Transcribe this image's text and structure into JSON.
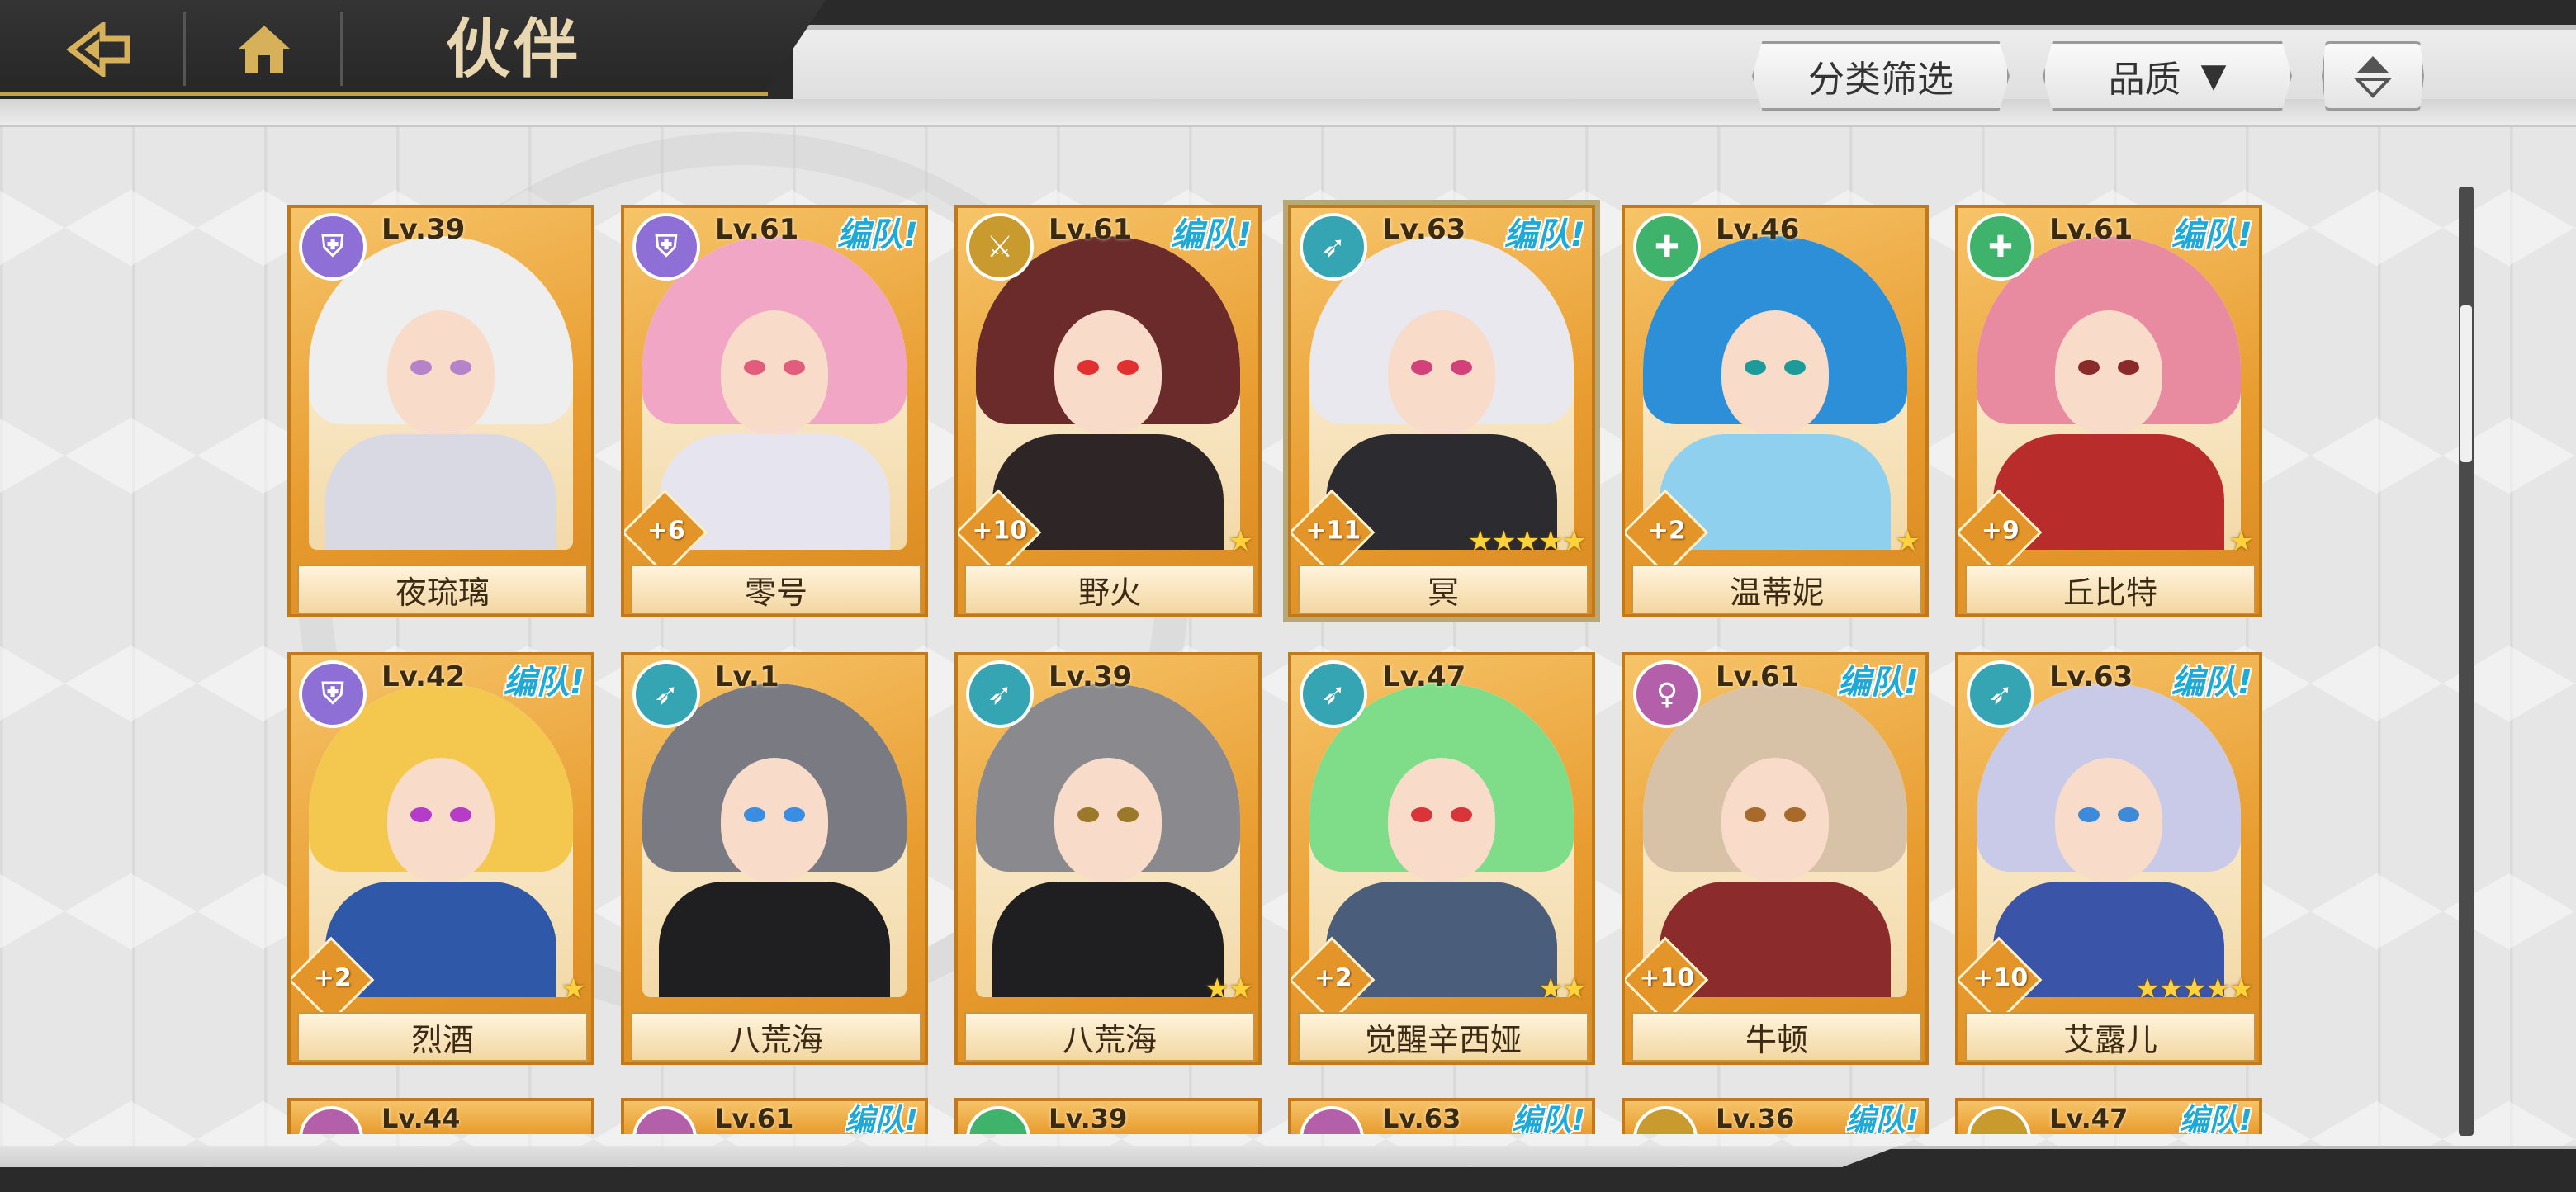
{
  "header": {
    "back_icon": "back-arrow-icon",
    "home_icon": "home-icon",
    "title": "伙伴"
  },
  "controls": {
    "filter_label": "分类筛选",
    "quality_label": "品质",
    "quality_arrow": "▼",
    "sort_icon": "sort-toggle-icon"
  },
  "colors": {
    "badge_purple": "#8e6fd6",
    "badge_teal": "#36a5b3",
    "badge_green": "#3fb36c",
    "badge_gold": "#c99a2e",
    "badge_pink": "#b45fa9",
    "team_blue": "#1fa9d6"
  },
  "cards": [
    {
      "name": "夜琉璃",
      "level": "Lv.39",
      "team": "",
      "plus": "",
      "stars": 0,
      "class": "shield",
      "badge": "#8e6fd6",
      "hair": "#eeeeee",
      "body": "#d9d9e3",
      "eye": "#b583c9"
    },
    {
      "name": "零号",
      "level": "Lv.61",
      "team": "编队!",
      "plus": "+6",
      "stars": 0,
      "class": "shield",
      "badge": "#8e6fd6",
      "hair": "#f0a6c4",
      "body": "#e6e4ee",
      "eye": "#e25d7b"
    },
    {
      "name": "野火",
      "level": "Lv.61",
      "team": "编队!",
      "plus": "+10",
      "stars": 1,
      "class": "dagger",
      "badge": "#c99a2e",
      "hair": "#6b2b2b",
      "body": "#2e2626",
      "eye": "#e22f2f"
    },
    {
      "name": "冥",
      "level": "Lv.63",
      "team": "编队!",
      "plus": "+11",
      "stars": 5,
      "class": "bow",
      "badge": "#36a5b3",
      "hair": "#e8e8ee",
      "body": "#2b2b30",
      "eye": "#d3407a"
    },
    {
      "name": "温蒂妮",
      "level": "Lv.46",
      "team": "",
      "plus": "+2",
      "stars": 1,
      "class": "heal",
      "badge": "#3fb36c",
      "hair": "#2c8fd8",
      "body": "#8fd0ee",
      "eye": "#1e9a9a"
    },
    {
      "name": "丘比特",
      "level": "Lv.61",
      "team": "编队!",
      "plus": "+9",
      "stars": 1,
      "class": "heal",
      "badge": "#3fb36c",
      "hair": "#e88aa0",
      "body": "#b82c2c",
      "eye": "#8a2a2a"
    },
    {
      "name": "烈酒",
      "level": "Lv.42",
      "team": "编队!",
      "plus": "+2",
      "stars": 1,
      "class": "shield",
      "badge": "#8e6fd6",
      "hair": "#f4c74e",
      "body": "#2f58a8",
      "eye": "#b43cc9"
    },
    {
      "name": "八荒海",
      "level": "Lv.1",
      "team": "",
      "plus": "",
      "stars": 0,
      "class": "bow",
      "badge": "#36a5b3",
      "hair": "#7a7a82",
      "body": "#1f1f22",
      "eye": "#3a8de0"
    },
    {
      "name": "八荒海",
      "level": "Lv.39",
      "team": "",
      "plus": "",
      "stars": 2,
      "class": "bow",
      "badge": "#36a5b3",
      "hair": "#8a8a8e",
      "body": "#1f1f22",
      "eye": "#9a7a2a"
    },
    {
      "name": "觉醒辛西娅",
      "level": "Lv.47",
      "team": "",
      "plus": "+2",
      "stars": 2,
      "class": "bow",
      "badge": "#36a5b3",
      "hair": "#7fdc88",
      "body": "#4a5d7a",
      "eye": "#d8343a"
    },
    {
      "name": "牛顿",
      "level": "Lv.61",
      "team": "编队!",
      "plus": "+10",
      "stars": 0,
      "class": "magic",
      "badge": "#b45fa9",
      "hair": "#d7c2a8",
      "body": "#8c2b2b",
      "eye": "#a86a2a"
    },
    {
      "name": "艾露儿",
      "level": "Lv.63",
      "team": "编队!",
      "plus": "+10",
      "stars": 5,
      "class": "bow",
      "badge": "#36a5b3",
      "hair": "#c9c9e8",
      "body": "#3a55a8",
      "eye": "#3d8ad8"
    }
  ],
  "partial_cards": [
    {
      "level": "Lv.44",
      "team": "",
      "badge": "#b45fa9"
    },
    {
      "level": "Lv.61",
      "team": "编队!",
      "badge": "#b45fa9"
    },
    {
      "level": "Lv.39",
      "team": "",
      "badge": "#3fb36c"
    },
    {
      "level": "Lv.63",
      "team": "编队!",
      "badge": "#b45fa9"
    },
    {
      "level": "Lv.36",
      "team": "编队!",
      "badge": "#c99a2e"
    },
    {
      "level": "Lv.47",
      "team": "编队!",
      "badge": "#c99a2e"
    }
  ]
}
